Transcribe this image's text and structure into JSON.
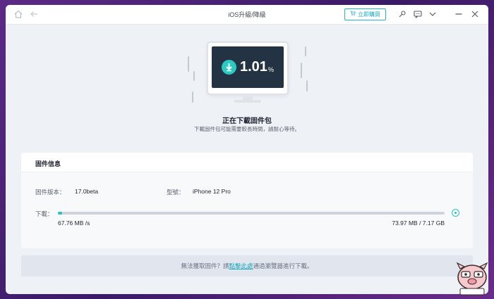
{
  "window": {
    "title": "iOS升級/降級",
    "buy_label": "立即購買"
  },
  "hero": {
    "percent_number": "1.01",
    "percent_sign": "%",
    "status_title": "正在下載固件包",
    "status_subtitle": "下載固件包可能需要較長時間，請耐心等待。"
  },
  "firmware": {
    "section_title": "固件信息",
    "version_label": "固件版本：",
    "version_value": "17.0beta",
    "model_label": "型號：",
    "model_value": "iPhone 12 Pro",
    "download_label": "下載：",
    "progress_fraction": 0.0101,
    "speed": "67.76 MB /s",
    "size": "73.97 MB / 7.17 GB"
  },
  "footer": {
    "text_before": "無法獲取固件？請",
    "link_text": "點擊此處",
    "text_after": "通過瀏覽器進行下載。"
  },
  "colors": {
    "accent": "#22c3c0",
    "screen": "#243344"
  }
}
